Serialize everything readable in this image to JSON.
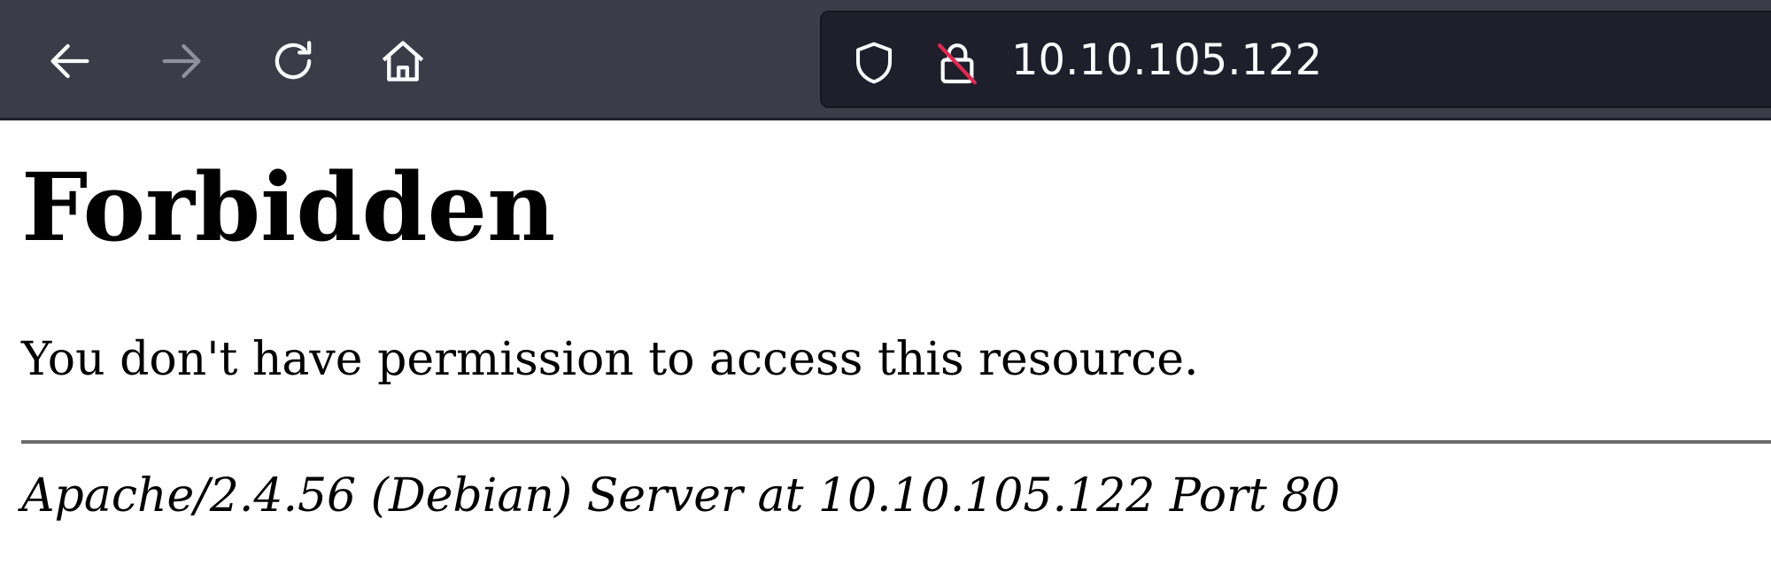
{
  "browser": {
    "nav_buttons": {
      "back_icon": "arrow-left",
      "forward_icon": "arrow-right",
      "reload_icon": "reload",
      "home_icon": "house"
    },
    "urlbar": {
      "tracking_icon": "shield",
      "connection_icon": "lock-crossed",
      "url": "10.10.105.122"
    },
    "colors": {
      "toolbar": "#3b3c47",
      "urlbar": "#1f1f2b",
      "insecure_slash": "#e22850"
    }
  },
  "page": {
    "title": "Forbidden",
    "message": "You don't have permission to access this resource.",
    "server_signature": "Apache/2.4.56 (Debian) Server at 10.10.105.122 Port 80"
  }
}
